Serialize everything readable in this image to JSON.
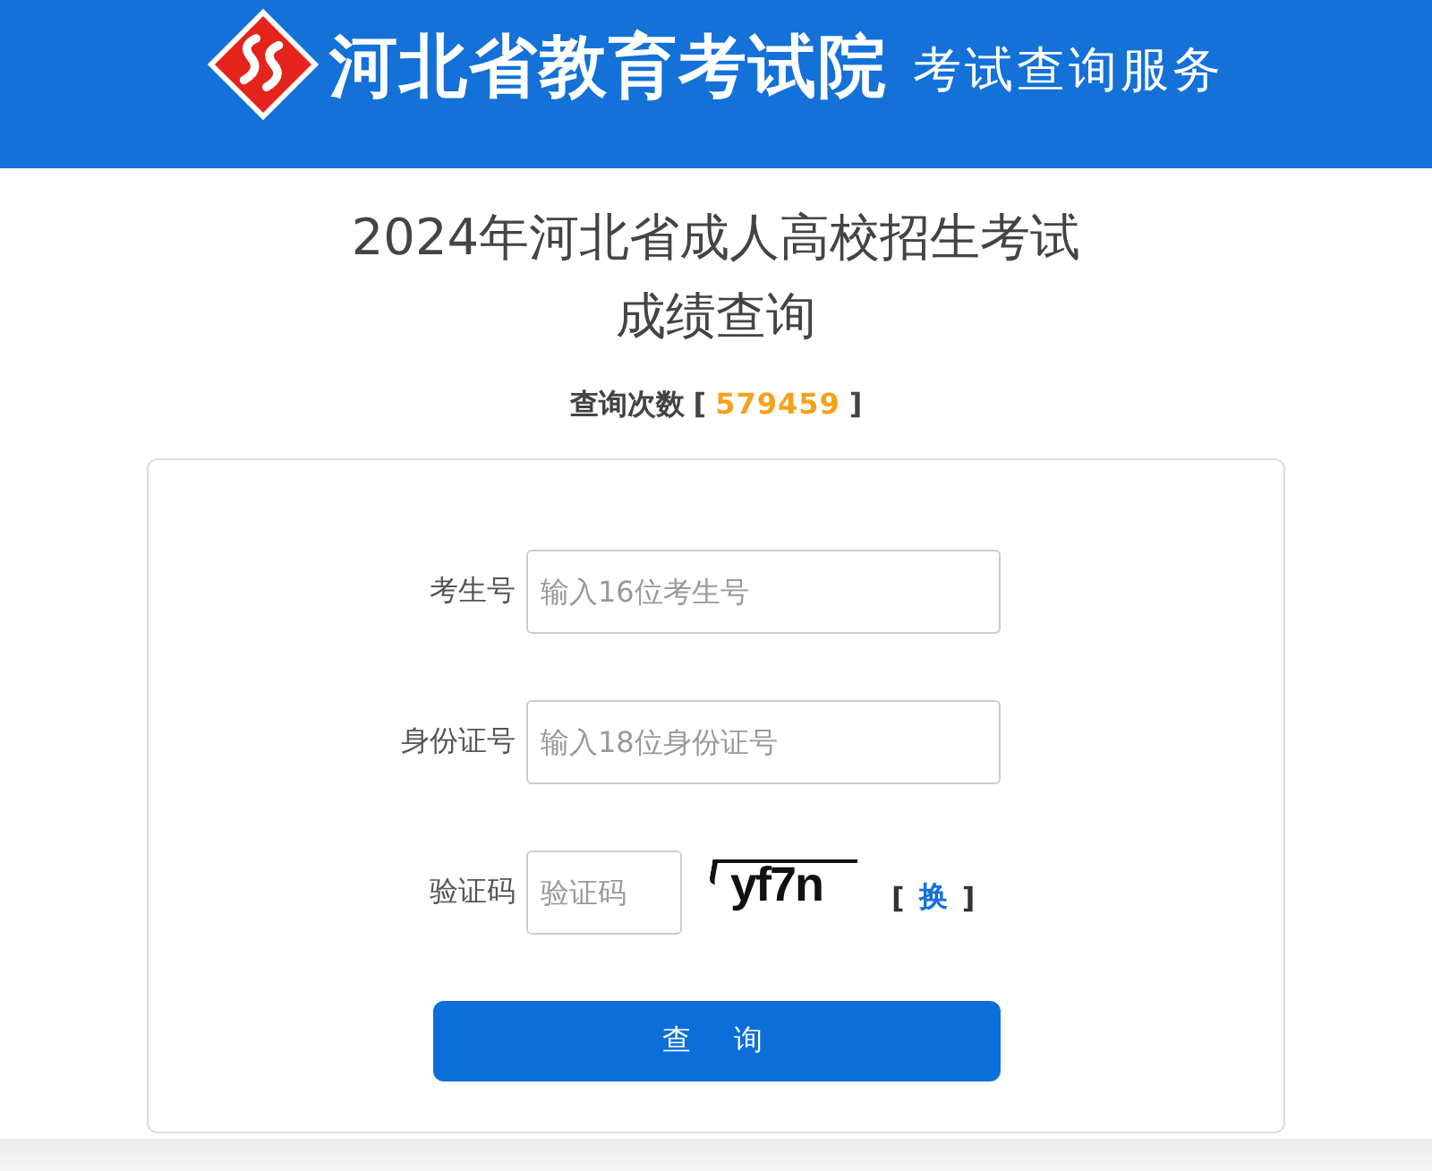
{
  "header": {
    "title": "河北省教育考试院",
    "subtitle": "考试查询服务"
  },
  "title_lines": [
    "2024年河北省成人高校招生考试",
    "成绩查询"
  ],
  "query_count": {
    "label": "查询次数",
    "bracket_open": "[",
    "value": "579459",
    "bracket_close": "]"
  },
  "form": {
    "fields": [
      {
        "kind": "text",
        "label": "考生号",
        "placeholder": "输入16位考生号"
      },
      {
        "kind": "text",
        "label": "身份证号",
        "placeholder": "输入18位身份证号"
      },
      {
        "kind": "captcha",
        "label": "验证码",
        "placeholder": "验证码",
        "captcha_text": "yf7n",
        "refresh": {
          "bracket_open": "[",
          "label": "换",
          "bracket_close": "]"
        }
      }
    ],
    "submit": "查　询"
  }
}
